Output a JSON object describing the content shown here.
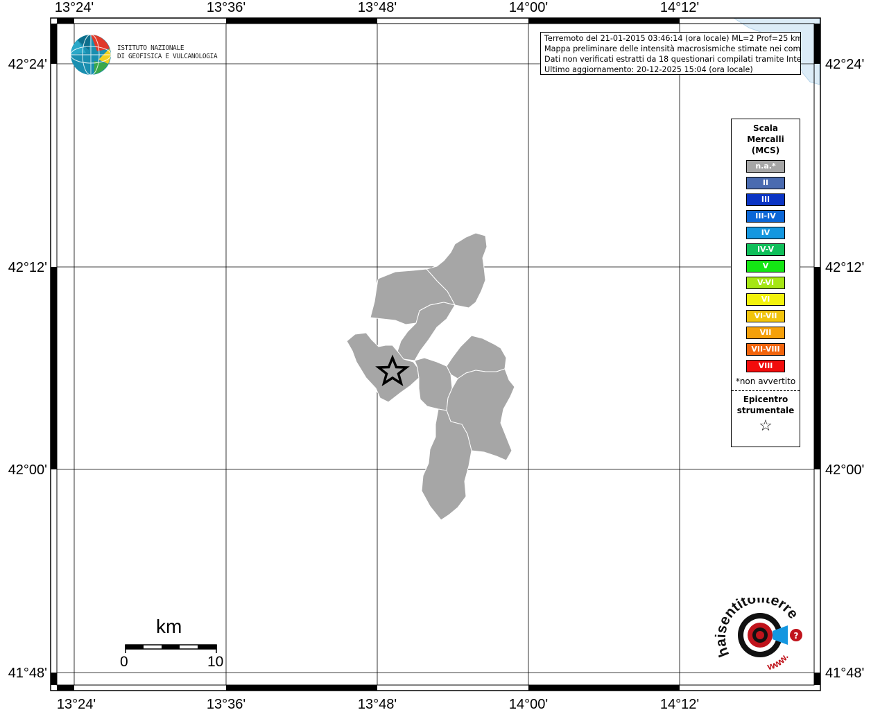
{
  "map": {
    "lon_ticks": [
      "13°24'",
      "13°36'",
      "13°48'",
      "14°00'",
      "14°12'"
    ],
    "lat_ticks": [
      "42°24'",
      "42°12'",
      "42°00'",
      "41°48'"
    ]
  },
  "logo": {
    "line1": "ISTITUTO NAZIONALE",
    "line2": "DI GEOFISICA E VULCANOLOGIA"
  },
  "info": {
    "line1": "Terremoto del 21-01-2015 03:46:14 (ora locale) ML=2 Prof=25 km",
    "line2": "Mappa preliminare delle intensità macrosismiche stimate nei comuni",
    "line3": "Dati non verificati estratti da 18 questionari compilati tramite Internet.",
    "line4": "Ultimo aggiornamento: 20-12-2025 15:04 (ora locale)"
  },
  "legend": {
    "title_line1": "Scala",
    "title_line2": "Mercalli",
    "title_line3": "(MCS)",
    "items": [
      {
        "label": "n.a.*",
        "color": "#a6a6a6"
      },
      {
        "label": "II",
        "color": "#4a6bb0"
      },
      {
        "label": "III",
        "color": "#0a34c4"
      },
      {
        "label": "III-IV",
        "color": "#0b66d6"
      },
      {
        "label": "IV",
        "color": "#1497e0"
      },
      {
        "label": "IV-V",
        "color": "#0fbf5a"
      },
      {
        "label": "V",
        "color": "#14e614"
      },
      {
        "label": "V-VI",
        "color": "#a6e614"
      },
      {
        "label": "VI",
        "color": "#f2f20c"
      },
      {
        "label": "VI-VII",
        "color": "#f2c40c"
      },
      {
        "label": "VII",
        "color": "#f5a00a"
      },
      {
        "label": "VII-VIII",
        "color": "#f2640c"
      },
      {
        "label": "VIII",
        "color": "#f20c0c"
      }
    ],
    "note": "*non avvertito",
    "epicenter_line1": "Epicentro",
    "epicenter_line2": "strumentale"
  },
  "scale": {
    "unit": "km",
    "min": "0",
    "max": "10"
  },
  "haisentito": {
    "text": "haisentitoilterremoto.it",
    "www": "www."
  },
  "colors": {
    "region_fill": "#a6a6a6",
    "region_stroke": "#ffffff",
    "sea": "#dcecf7"
  }
}
